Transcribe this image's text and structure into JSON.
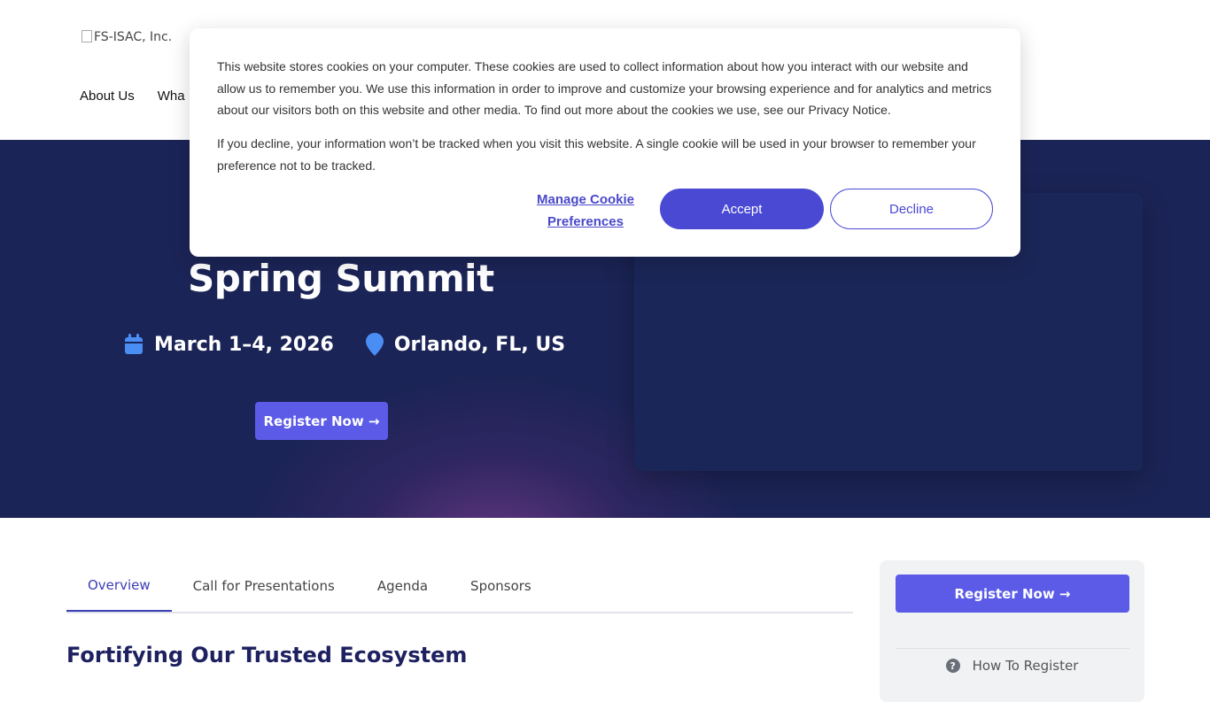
{
  "header": {
    "logo_alt": "FS-ISAC, Inc.",
    "nav": [
      {
        "label": "About Us"
      },
      {
        "label": "Wha"
      }
    ]
  },
  "hero": {
    "title": "Spring Summit",
    "date": "March 1–4, 2026",
    "location": "Orlando, FL, US",
    "register_label": "Register Now →",
    "icons": {
      "date": "calendar-icon",
      "location": "map-pin-icon"
    },
    "accent_color": "#5b5be8"
  },
  "tabs": [
    {
      "label": "Overview",
      "active": true
    },
    {
      "label": "Call for Presentations",
      "active": false
    },
    {
      "label": "Agenda",
      "active": false
    },
    {
      "label": "Sponsors",
      "active": false
    }
  ],
  "main": {
    "heading": "Fortifying Our Trusted Ecosystem"
  },
  "sidebar": {
    "register_label": "Register Now →",
    "help_label": "How To Register",
    "help_icon": "question-circle-icon"
  },
  "cookie_banner": {
    "paragraph1": "This website stores cookies on your computer. These cookies are used to collect information about how you interact with our website and allow us to remember you. We use this information in order to improve and customize your browsing experience and for analytics and metrics about our visitors both on this website and other media. To find out more about the cookies we use, see our Privacy Notice.",
    "paragraph2": "If you decline, your information won’t be tracked when you visit this website. A single cookie will be used in your browser to remember your preference not to be tracked.",
    "manage_label": "Manage Cookie Preferences",
    "accept_label": "Accept",
    "decline_label": "Decline"
  }
}
